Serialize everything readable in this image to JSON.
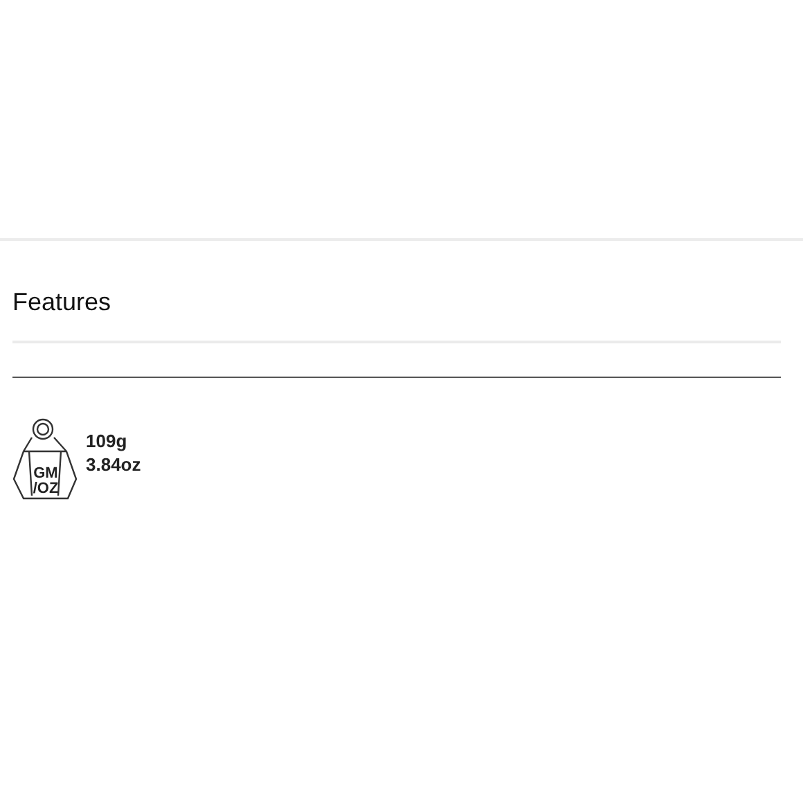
{
  "section": {
    "title": "Features"
  },
  "weight": {
    "icon_label": [
      "GM",
      "/OZ"
    ],
    "grams": "109g",
    "ounces": "3.84oz"
  }
}
